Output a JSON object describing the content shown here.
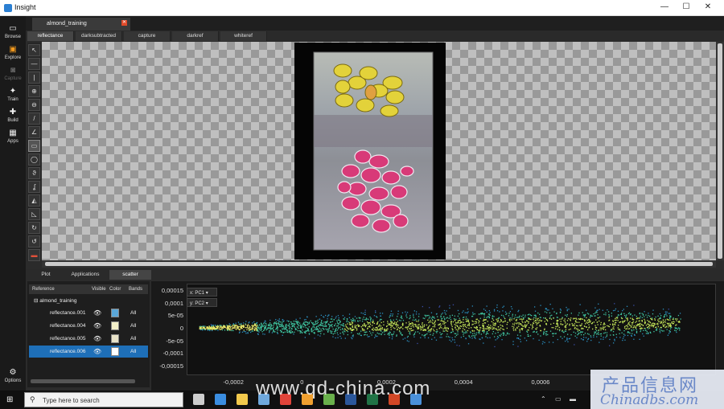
{
  "window": {
    "title": "Insight",
    "minimize": "—",
    "maximize": "☐",
    "close": "✕"
  },
  "sidebar": [
    {
      "label": "Browse",
      "icon": "folder-icon",
      "glyph": "▭",
      "state": "normal"
    },
    {
      "label": "Explore",
      "icon": "explore-icon",
      "glyph": "▣",
      "state": "active"
    },
    {
      "label": "Capture",
      "icon": "camera-icon",
      "glyph": "◙",
      "state": "disabled"
    },
    {
      "label": "Train",
      "icon": "train-icon",
      "glyph": "✦",
      "state": "normal"
    },
    {
      "label": "Build",
      "icon": "wrench-icon",
      "glyph": "✚",
      "state": "normal"
    },
    {
      "label": "Apps",
      "icon": "apps-grid-icon",
      "glyph": "▦",
      "state": "normal"
    }
  ],
  "options": {
    "label": "Options",
    "glyph": "⚙"
  },
  "document_tab": {
    "label": "almond_training",
    "close": "✕"
  },
  "view_tabs": [
    "reflectance",
    "darksubtracted",
    "capture",
    "darkref",
    "whiteref"
  ],
  "active_view_tab": 0,
  "tools": [
    {
      "name": "pointer-tool",
      "glyph": "↖"
    },
    {
      "name": "line-h-tool",
      "glyph": "—"
    },
    {
      "name": "line-v-tool",
      "glyph": "|"
    },
    {
      "name": "zoom-in-tool",
      "glyph": "⊕"
    },
    {
      "name": "zoom-out-tool",
      "glyph": "⊖"
    },
    {
      "name": "pen-tool",
      "glyph": "/"
    },
    {
      "name": "angle-tool",
      "glyph": "∠"
    },
    {
      "name": "rectangle-tool",
      "glyph": "▭"
    },
    {
      "name": "ellipse-tool",
      "glyph": "◯"
    },
    {
      "name": "lasso-tool",
      "glyph": "ϑ"
    },
    {
      "name": "freehand-tool",
      "glyph": "ʆ"
    },
    {
      "name": "fill-tool",
      "glyph": "◭"
    },
    {
      "name": "erase-tool",
      "glyph": "◺"
    },
    {
      "name": "rotate-cw-tool",
      "glyph": "↻"
    },
    {
      "name": "rotate-ccw-tool",
      "glyph": "↺"
    },
    {
      "name": "color-tool",
      "glyph": "▬"
    }
  ],
  "active_tool": 7,
  "bottom_tabs": [
    "Plot",
    "Applications",
    "scatter"
  ],
  "active_bottom_tab": 2,
  "ref_table": {
    "headers": {
      "reference": "Reference",
      "visible": "Visible",
      "color": "Color",
      "bands": "Bands"
    },
    "root": "almond_training",
    "rows": [
      {
        "name": "reflectance.001",
        "color": "#5aa7d8",
        "bands": "All",
        "selected": false
      },
      {
        "name": "reflectance.004",
        "color": "#f2efc8",
        "bands": "All",
        "selected": false
      },
      {
        "name": "reflectance.005",
        "color": "#e8e2c8",
        "bands": "All",
        "selected": false
      },
      {
        "name": "reflectance.006",
        "color": "#ffffff",
        "bands": "All",
        "selected": true
      }
    ]
  },
  "scatter": {
    "x_select": {
      "axis": "x:",
      "value": "PC1"
    },
    "y_select": {
      "axis": "y:",
      "value": "PC2"
    },
    "y_ticks": [
      "0,00015",
      "0,0001",
      "5e-05",
      "0",
      "-5e-05",
      "-0,0001",
      "-0,00015"
    ],
    "x_ticks": [
      "-0,0002",
      "0",
      "0,0002",
      "0,0004",
      "0,0006",
      "0,0008"
    ]
  },
  "chart_data": {
    "type": "scatter",
    "title": "",
    "xlabel": "PC1",
    "ylabel": "PC2",
    "xlim": [
      -0.00032,
      0.00105
    ],
    "ylim": [
      -0.00018,
      0.00018
    ],
    "density": "dense point cloud, high density (green/yellow) along center band",
    "x_tick_values": [
      -0.0002,
      0,
      0.0002,
      0.0004,
      0.0006,
      0.0008
    ],
    "y_tick_values": [
      0.00015,
      0.0001,
      5e-05,
      0,
      -5e-05,
      -0.0001,
      -0.00015
    ]
  },
  "taskbar": {
    "search_placeholder": "Type here to search",
    "apps": [
      {
        "name": "task-view-icon",
        "color": "#cccccc"
      },
      {
        "name": "edge-icon",
        "color": "#3a8de0"
      },
      {
        "name": "file-explorer-icon",
        "color": "#f2c94c"
      },
      {
        "name": "store-icon",
        "color": "#6fa8dc"
      },
      {
        "name": "chrome-icon",
        "color": "#e0443a"
      },
      {
        "name": "photos-icon",
        "color": "#f0a030"
      },
      {
        "name": "app-icon",
        "color": "#6ab04c"
      },
      {
        "name": "word-icon",
        "color": "#2b579a"
      },
      {
        "name": "excel-icon",
        "color": "#217346"
      },
      {
        "name": "powerpoint-icon",
        "color": "#d24726"
      },
      {
        "name": "insight-taskbar-icon",
        "color": "#4a90d9"
      }
    ]
  },
  "watermarks": {
    "site": "www.qd-china.com",
    "cn": "产品信息网",
    "en": "Chinadbs.com"
  }
}
